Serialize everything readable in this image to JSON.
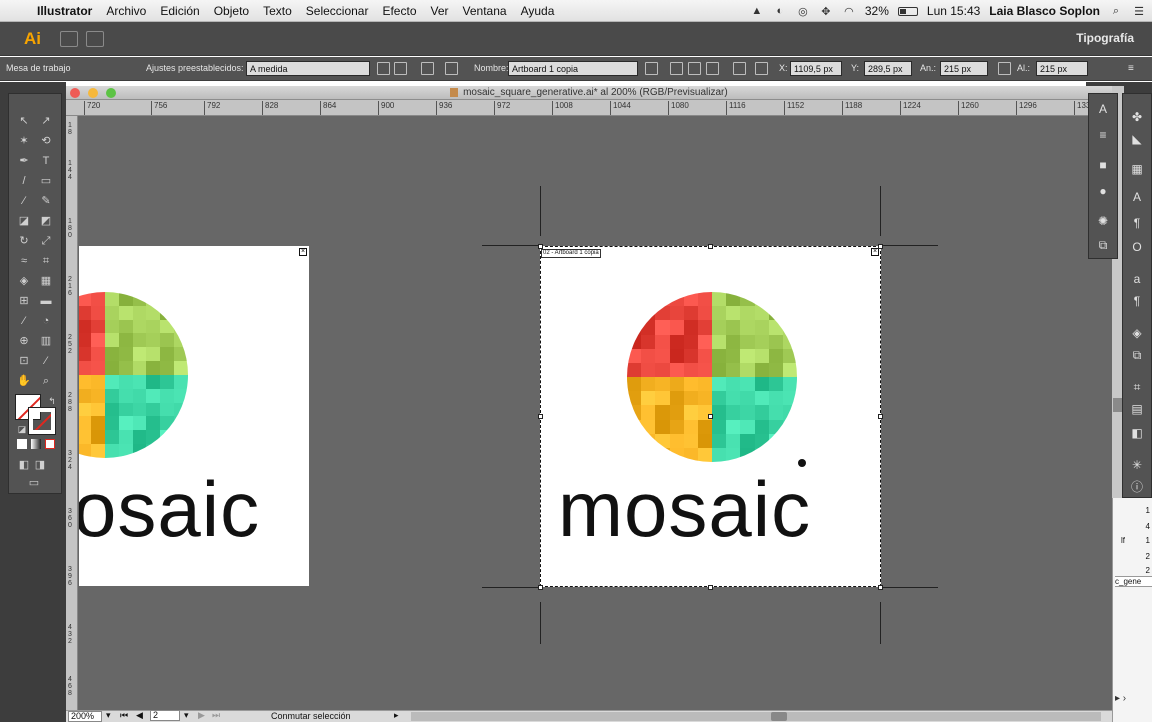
{
  "menubar": {
    "app_name": "Illustrator",
    "items": [
      "Archivo",
      "Edición",
      "Objeto",
      "Texto",
      "Seleccionar",
      "Efecto",
      "Ver",
      "Ventana",
      "Ayuda"
    ],
    "battery": "32%",
    "clock": "Lun 15:43",
    "user": "Laia Blasco Soplon"
  },
  "appbar": {
    "logo": "Ai",
    "workspace": "Tipografía"
  },
  "controlbar": {
    "context": "Mesa de trabajo",
    "preset_label": "Ajustes preestablecidos:",
    "preset_value": "A medida",
    "name_label": "Nombre:",
    "name_value": "Artboard 1 copia",
    "x_label": "X:",
    "x_value": "1109,5 px",
    "y_label": "Y:",
    "y_value": "289,5 px",
    "w_label": "An.:",
    "w_value": "215 px",
    "h_label": "Al.:",
    "h_value": "215 px"
  },
  "document": {
    "title": "mosaic_square_generative.ai* al 200% (RGB/Previsualizar)",
    "ruler_h": [
      "720",
      "756",
      "792",
      "828",
      "864",
      "900",
      "936",
      "972",
      "1008",
      "1044",
      "1080",
      "1116",
      "1152",
      "1188",
      "1224",
      "1260",
      "1296",
      "1332"
    ],
    "ruler_v": [
      "1 8",
      "1 4 4",
      "1 8 0",
      "2 1 6",
      "2 5 2",
      "2 8 8",
      "3 2 4",
      "3 6 0",
      "3 9 6",
      "4 3 2",
      "4 6 8"
    ],
    "artboard_left_word": "osaic",
    "artboard_right_word": "mosaic",
    "artboard_right_label": "02 - Artboard 1 copia"
  },
  "statusbar": {
    "zoom": "200%",
    "page": "2",
    "selection_tool": "Conmutar selección"
  },
  "peek_panel": {
    "values": [
      "1",
      "4",
      "1",
      "2",
      "2"
    ],
    "partial_name": "c_gene",
    "partial_text": "lf"
  },
  "colors": {
    "red": "#e8453c",
    "green": "#a5cf5a",
    "orange": "#f7b425",
    "teal": "#3dd6a5",
    "canvas_gray": "#676767",
    "ai_orange": "#f7a400"
  }
}
